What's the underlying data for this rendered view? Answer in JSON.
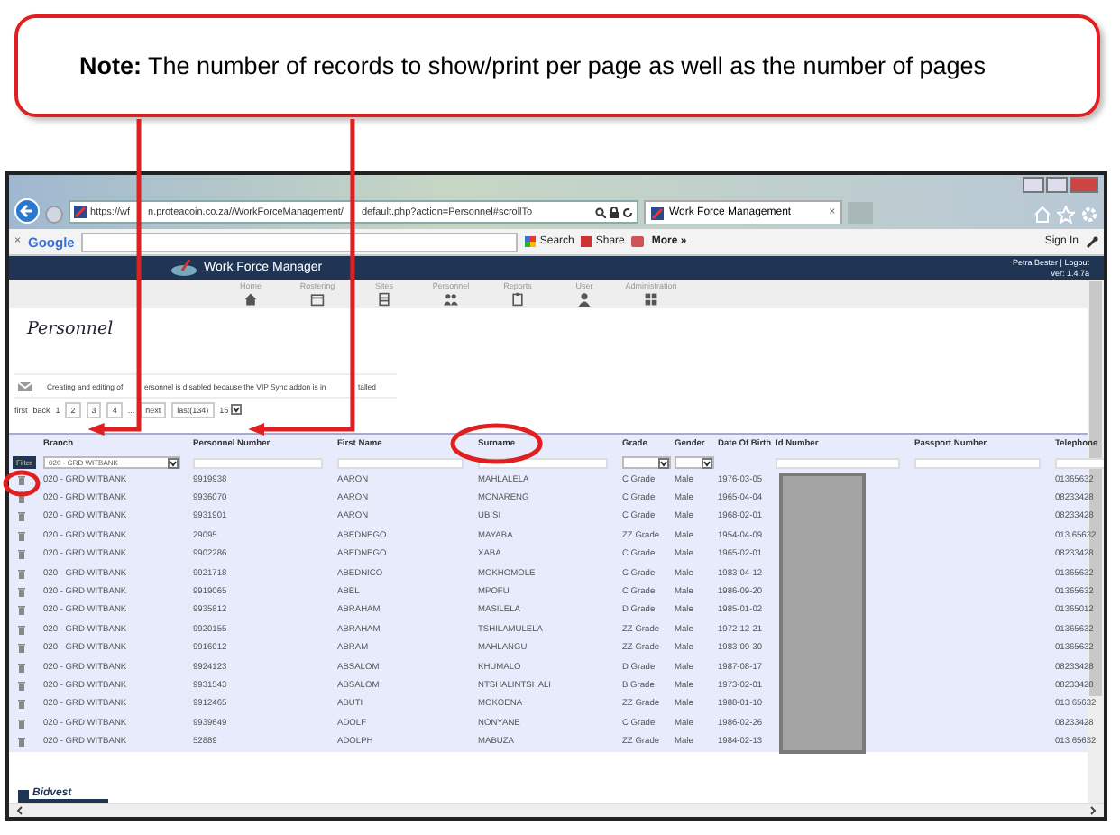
{
  "callout": {
    "text": "**Note:** The number of records to show/print per page as well as the number of pages"
  },
  "browser": {
    "url": [
      "https://wf",
      "n.proteacoin.co.za//WorkForceManagement/",
      "default.php?action=Personnel#scrollTo"
    ],
    "tab": "Work Force Management",
    "tab_close": "×",
    "toolbar": {
      "close": "×",
      "brand": "Google",
      "search": "Search",
      "share": "Share",
      "more": "More »",
      "sign_in": "Sign In"
    }
  },
  "app": {
    "title": "Work Force Manager",
    "user": "Petra Bester | Logout",
    "version": "ver: 1.4.7a",
    "nav": [
      {
        "label": "Home",
        "kind": "home"
      },
      {
        "label": "Rostering",
        "kind": "calendar"
      },
      {
        "label": "Sites",
        "kind": "building"
      },
      {
        "label": "Personnel",
        "kind": "people"
      },
      {
        "label": "Reports",
        "kind": "clipboard"
      },
      {
        "label": "User",
        "kind": "person"
      },
      {
        "label": "Administration",
        "kind": "grid"
      }
    ],
    "page_title": "Personnel",
    "notice": [
      "Creating and editing of",
      "ersonnel is disabled because the VIP Sync addon is in",
      "talled"
    ],
    "pagination": {
      "links": [
        "first",
        "back"
      ],
      "current": "1",
      "pages": [
        "2",
        "3",
        "4"
      ],
      "ellipsis": "...",
      "next": "next",
      "last": "last(134)",
      "page_size": "15"
    },
    "table": {
      "columns": [
        "Branch",
        "Personnel Number",
        "First Name",
        "Surname",
        "Grade",
        "Gender",
        "Date Of Birth",
        "Id Number",
        "Passport Number",
        "Telephone"
      ],
      "filter": {
        "button": "Filter",
        "branch": "020 - GRD WITBANK"
      },
      "rows": [
        [
          "020 - GRD WITBANK",
          "9919938",
          "AARON",
          "MAHLALELA",
          "C Grade",
          "Male",
          "1976-03-05",
          "01365632"
        ],
        [
          "020 - GRD WITBANK",
          "9936070",
          "AARON",
          "MONARENG",
          "C Grade",
          "Male",
          "1965-04-04",
          "08233428"
        ],
        [
          "020 - GRD WITBANK",
          "9931901",
          "AARON",
          "UBISI",
          "C Grade",
          "Male",
          "1968-02-01",
          "08233428"
        ],
        [
          "020 - GRD WITBANK",
          "29095",
          "ABEDNEGO",
          "MAYABA",
          "ZZ Grade",
          "Male",
          "1954-04-09",
          "013 65632"
        ],
        [
          "020 - GRD WITBANK",
          "9902286",
          "ABEDNEGO",
          "XABA",
          "C Grade",
          "Male",
          "1965-02-01",
          "08233428"
        ],
        [
          "020 - GRD WITBANK",
          "9921718",
          "ABEDNICO",
          "MOKHOMOLE",
          "C Grade",
          "Male",
          "1983-04-12",
          "01365632"
        ],
        [
          "020 - GRD WITBANK",
          "9919065",
          "ABEL",
          "MPOFU",
          "C Grade",
          "Male",
          "1986-09-20",
          "01365632"
        ],
        [
          "020 - GRD WITBANK",
          "9935812",
          "ABRAHAM",
          "MASILELA",
          "D Grade",
          "Male",
          "1985-01-02",
          "01365012"
        ],
        [
          "020 - GRD WITBANK",
          "9920155",
          "ABRAHAM",
          "TSHILAMULELA",
          "ZZ Grade",
          "Male",
          "1972-12-21",
          "01365632"
        ],
        [
          "020 - GRD WITBANK",
          "9916012",
          "ABRAM",
          "MAHLANGU",
          "ZZ Grade",
          "Male",
          "1983-09-30",
          "01365632"
        ],
        [
          "020 - GRD WITBANK",
          "9924123",
          "ABSALOM",
          "KHUMALO",
          "D Grade",
          "Male",
          "1987-08-17",
          "08233428"
        ],
        [
          "020 - GRD WITBANK",
          "9931543",
          "ABSALOM",
          "NTSHALINTSHALI",
          "B Grade",
          "Male",
          "1973-02-01",
          "08233428"
        ],
        [
          "020 - GRD WITBANK",
          "9912465",
          "ABUTI",
          "MOKOENA",
          "ZZ Grade",
          "Male",
          "1988-01-10",
          "013 65632"
        ],
        [
          "020 - GRD WITBANK",
          "9939649",
          "ADOLF",
          "NONYANE",
          "C Grade",
          "Male",
          "1986-02-26",
          "08233428"
        ],
        [
          "020 - GRD WITBANK",
          "52889",
          "ADOLPH",
          "MABUZA",
          "ZZ Grade",
          "Male",
          "1984-02-13",
          "013 65632"
        ]
      ]
    },
    "footer_logo": "Bidvest"
  }
}
